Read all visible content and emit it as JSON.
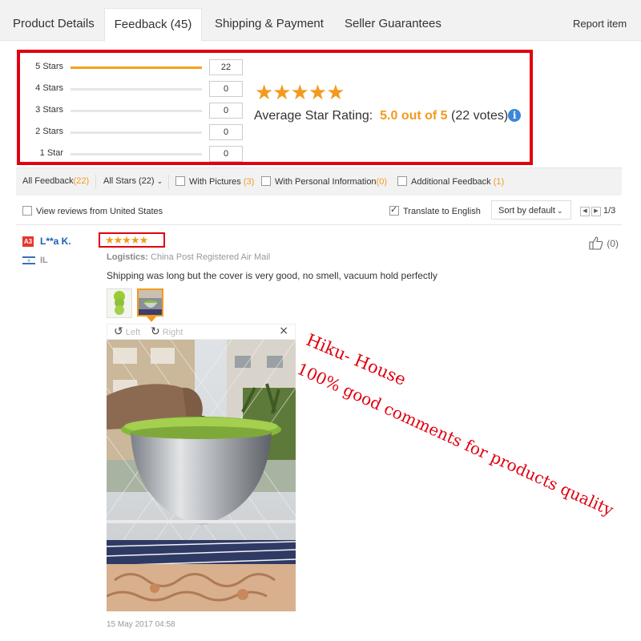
{
  "tabs": [
    {
      "label": "Product Details"
    },
    {
      "label": "Feedback (45)"
    },
    {
      "label": "Shipping & Payment"
    },
    {
      "label": "Seller Guarantees"
    }
  ],
  "report_item": "Report item",
  "rating_summary": {
    "rows": [
      {
        "label": "5 Stars",
        "count": "22",
        "fraction": 1.0
      },
      {
        "label": "4 Stars",
        "count": "0",
        "fraction": 0
      },
      {
        "label": "3 Stars",
        "count": "0",
        "fraction": 0
      },
      {
        "label": "2 Stars",
        "count": "0",
        "fraction": 0
      },
      {
        "label": "1 Star",
        "count": "0",
        "fraction": 0
      }
    ],
    "stars_display": "★★★★★",
    "avg_label": "Average Star Rating:",
    "avg_value": "5.0 out of 5",
    "votes": "(22 votes)",
    "info_glyph": "i"
  },
  "filters": {
    "all_feedback": "All Feedback",
    "all_feedback_count": "(22)",
    "all_stars": "All Stars (22)",
    "with_pictures": "With Pictures",
    "with_pictures_count": "(3)",
    "with_personal_info": "With Personal Information",
    "with_personal_info_count": "(0)",
    "additional_feedback": "Additional Feedback",
    "additional_feedback_count": "(1)",
    "view_us": "View reviews from United States",
    "translate": "Translate to English",
    "sort": "Sort by default",
    "page": "1/3"
  },
  "review": {
    "badge": "A3",
    "user": "L**a K.",
    "country": "IL",
    "stars": "★★★★★",
    "likes": "(0)",
    "logistics_label": "Logistics:",
    "logistics_value": "China Post Registered Air Mail",
    "comment": "Shipping was long but the cover is very good, no smell, vacuum hold perfectly",
    "viewer_left": "Left",
    "viewer_right": "Right",
    "date": "15 May 2017 04:58"
  },
  "watermark": {
    "line1": "Hiku- House",
    "line2": "100% good comments for products quality"
  },
  "colors": {
    "accent_orange": "#f39a1e",
    "highlight_red": "#e00010",
    "link_blue": "#1a5fb4",
    "info_blue": "#3a87d4"
  },
  "icons": [
    "info-icon",
    "checkbox-icon",
    "chevron-down-icon",
    "thumbs-up-icon",
    "rotate-left-icon",
    "rotate-right-icon",
    "close-icon",
    "flag-icon",
    "prev-page-icon",
    "next-page-icon"
  ]
}
